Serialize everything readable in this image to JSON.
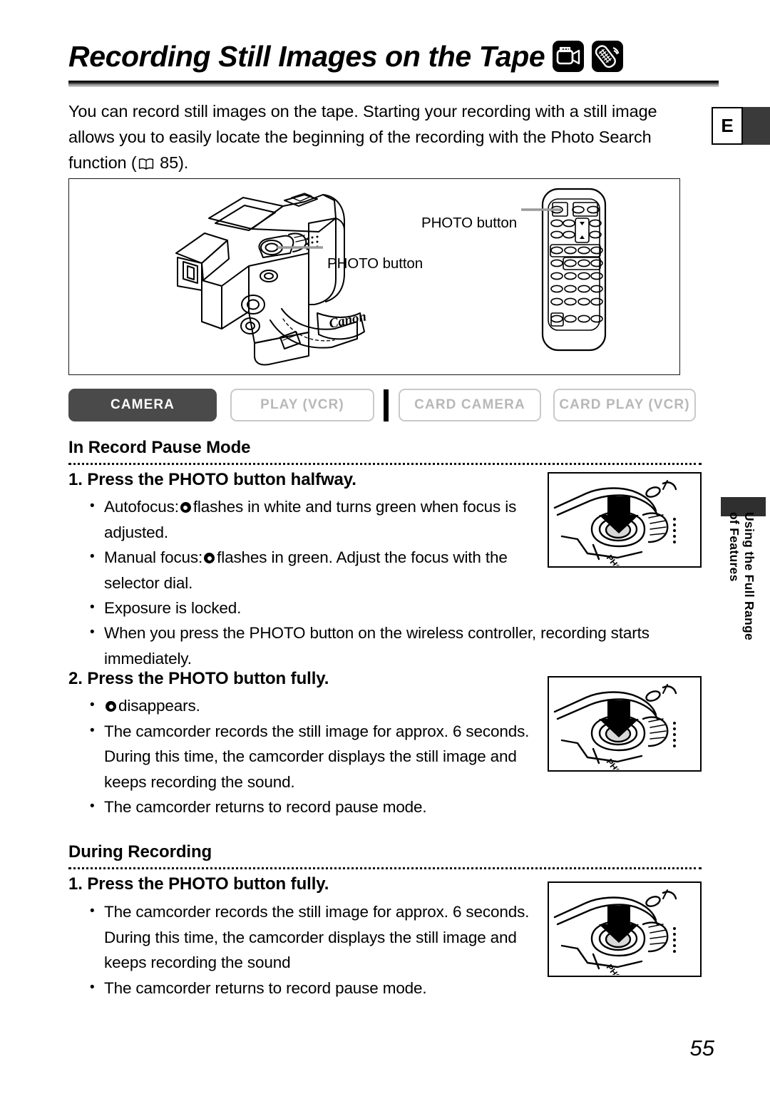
{
  "header": {
    "title": "Recording Still Images on the Tape",
    "badges": [
      {
        "name": "camcorder-icon"
      },
      {
        "name": "wireless-controller-icon"
      }
    ],
    "language_tab": "E"
  },
  "intro": {
    "part1": "You can record still images on the tape. Starting your recording with a still image allows you to easily locate the beginning of the recording with the Photo Search function (",
    "page_ref": "85",
    "part2": ")."
  },
  "illustration": {
    "camcorder_label": "PHOTO button",
    "remote_label": "PHOTO button",
    "brand": "Canon"
  },
  "mode_bar": {
    "modes": [
      {
        "label": "CAMERA",
        "active": true
      },
      {
        "label": "PLAY (VCR)",
        "active": false
      },
      {
        "label": "CARD CAMERA",
        "active": false
      },
      {
        "label": "CARD PLAY (VCR)",
        "active": false
      }
    ]
  },
  "sections": [
    {
      "heading": "In Record Pause Mode",
      "steps": [
        {
          "title": "1. Press the PHOTO button halfway.",
          "bullets": [
            {
              "pre": "Autofocus:",
              "glyph": true,
              "post": "flashes in white and turns green when focus is adjusted."
            },
            {
              "pre": "Manual focus:",
              "glyph": true,
              "post": "flashes in green. Adjust the focus with the selector dial."
            },
            {
              "pre": "",
              "glyph": false,
              "post": "Exposure is locked."
            },
            {
              "pre": "",
              "glyph": false,
              "post": "When you press the PHOTO button on the wireless controller, recording starts immediately."
            }
          ]
        },
        {
          "title": "2. Press the PHOTO button fully.",
          "bullets": [
            {
              "pre": "",
              "glyph": true,
              "post": "disappears."
            },
            {
              "pre": "",
              "glyph": false,
              "post": "The camcorder records the still image for approx. 6 seconds. During this time, the camcorder displays the still image and keeps recording the sound."
            },
            {
              "pre": "",
              "glyph": false,
              "post": "The camcorder returns to record pause mode."
            }
          ]
        }
      ]
    },
    {
      "heading": "During Recording",
      "steps": [
        {
          "title": "1. Press the PHOTO button fully.",
          "bullets": [
            {
              "pre": "",
              "glyph": false,
              "post": "The camcorder records the still image for approx. 6 seconds. During this time, the camcorder displays the still image and keeps recording the sound"
            },
            {
              "pre": "",
              "glyph": false,
              "post": "The camcorder returns to record pause mode."
            }
          ]
        }
      ]
    }
  ],
  "thumbnails": [
    {
      "name": "photo-button-press-halfway",
      "caption": "PHOTO"
    },
    {
      "name": "photo-button-press-fully",
      "caption": "PHOTO"
    },
    {
      "name": "photo-button-press-during-recording",
      "caption": "PHOTO"
    }
  ],
  "side_tab": {
    "line1": "Using the Full Range",
    "line2": "of Features"
  },
  "page_number": "55"
}
